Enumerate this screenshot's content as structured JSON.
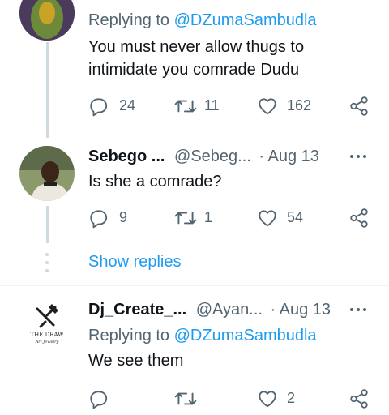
{
  "tweet1": {
    "reply_prefix": "Replying to ",
    "reply_handle": "@DZumaSambudla",
    "text_line1": "You must never allow thugs to",
    "text_line2": "intimidate you comrade Dudu",
    "replies": "24",
    "retweets": "11",
    "likes": "162"
  },
  "tweet2": {
    "name": "Sebego ...",
    "handle": "@Sebeg...",
    "date": "· Aug 13",
    "text": "Is she a comrade?",
    "replies": "9",
    "retweets": "1",
    "likes": "54"
  },
  "show_replies": "Show replies",
  "tweet3": {
    "name": "Dj_Create_...",
    "handle": "@Ayan...",
    "date": "· Aug 13",
    "reply_prefix": "Replying to ",
    "reply_handle": "@DZumaSambudla",
    "text": "We see them",
    "likes": "2",
    "avatar_logo_line1": "THE DRAW",
    "avatar_logo_line2": "Art Jewelry"
  },
  "icons": {
    "reply": "reply-icon",
    "retweet": "retweet-icon",
    "like": "heart-icon",
    "share": "share-icon",
    "more": "more-options-icon"
  },
  "colors": {
    "accent": "#1d9bf0",
    "secondary_text": "#536471",
    "thread_line": "#cfd9de"
  }
}
